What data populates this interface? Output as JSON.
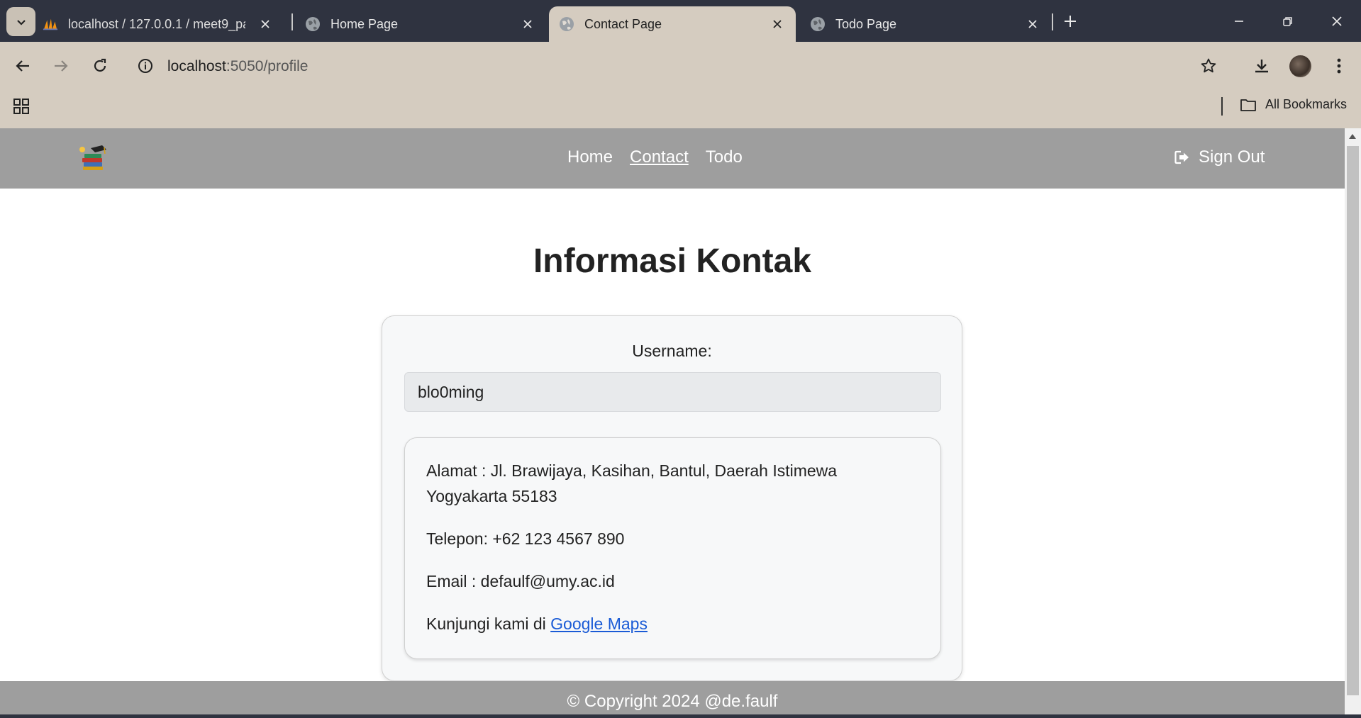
{
  "browser": {
    "tabs": [
      {
        "title": "localhost / 127.0.0.1 / meet9_pa",
        "active": false
      },
      {
        "title": "Home Page",
        "active": false
      },
      {
        "title": "Contact Page",
        "active": true
      },
      {
        "title": "Todo Page",
        "active": false
      }
    ],
    "url_host": "localhost",
    "url_rest": ":5050/profile",
    "bookmarks_label": "All Bookmarks"
  },
  "page": {
    "nav": {
      "links": [
        "Home",
        "Contact",
        "Todo"
      ],
      "current": "Contact",
      "signout_label": "Sign Out"
    },
    "heading": "Informasi Kontak",
    "username_label": "Username:",
    "username_value": "blo0ming",
    "info": {
      "alamat": "Alamat : Jl. Brawijaya, Kasihan, Bantul, Daerah Istimewa Yogyakarta 55183",
      "telepon": "Telepon: +62 123 4567 890",
      "email": "Email : defaulf@umy.ac.id",
      "visit_prefix": "Kunjungi kami di ",
      "maps_link": "Google Maps"
    },
    "footer": "© Copyright 2024 @de.faulf"
  },
  "colors": {
    "tabbar_bg": "#2f3340",
    "toolbar_bg": "#d5ccc0",
    "navbar_bg": "#9e9e9e",
    "link_blue": "#1a5bd6"
  }
}
